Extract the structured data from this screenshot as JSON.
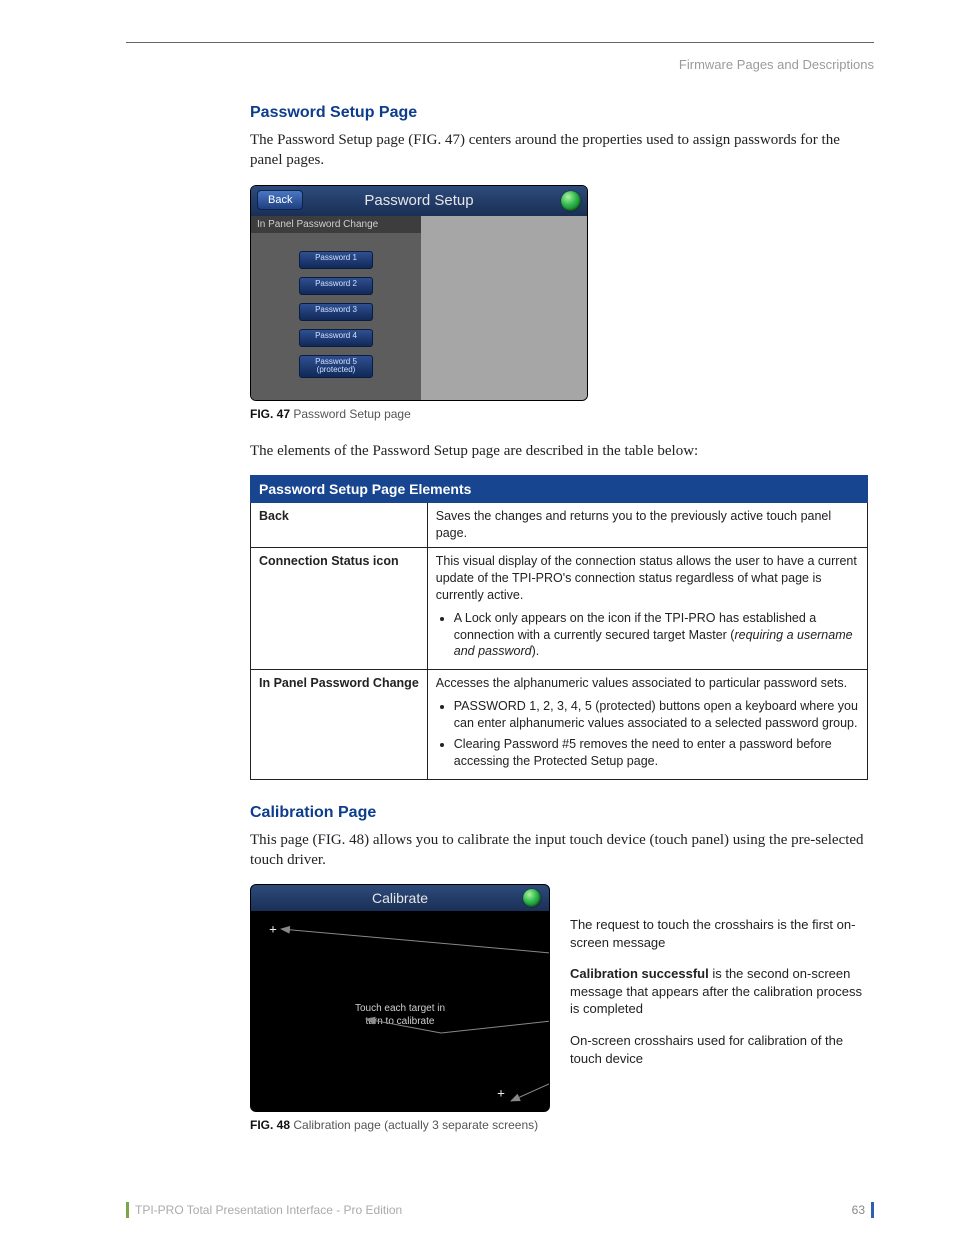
{
  "header": {
    "breadcrumb": "Firmware Pages and Descriptions"
  },
  "section1": {
    "title": "Password Setup Page",
    "intro": "The Password Setup page (FIG. 47) centers around the properties used to assign passwords for the panel pages."
  },
  "fig47": {
    "back_label": "Back",
    "panel_title": "Password Setup",
    "left_header": "In Panel Password Change",
    "buttons": [
      "Password 1",
      "Password 2",
      "Password 3",
      "Password 4",
      "Password 5\n(protected)"
    ],
    "caption_bold": "FIG. 47",
    "caption_rest": "  Password Setup page"
  },
  "table_intro": "The elements of the Password Setup page are described in the table below:",
  "table": {
    "header": "Password Setup Page Elements",
    "rows": [
      {
        "key": "Back",
        "desc": "Saves the changes and returns you to the previously active touch panel page."
      },
      {
        "key": "Connection Status icon",
        "desc": "This visual display of the connection status allows the user to have a current update of the TPI-PRO's connection status regardless of what page is currently active.",
        "bullets": [
          {
            "pre": "A Lock only appears on the icon if the TPI-PRO has established a connection with a currently secured target Master (",
            "ital": "requiring a username and password",
            "post": ")."
          }
        ]
      },
      {
        "key": "In Panel Password Change",
        "desc": "Accesses the alphanumeric values associated to particular password sets.",
        "bullets": [
          {
            "pre": "PASSWORD 1, 2, 3, 4, 5 (protected) buttons open a keyboard where you can enter alphanumeric values associated to a selected password group."
          },
          {
            "pre": "Clearing Password #5 removes the need to enter a password before accessing the Protected Setup page."
          }
        ]
      }
    ]
  },
  "section2": {
    "title": "Calibration Page",
    "intro": "This page (FIG. 48) allows you to calibrate the input touch device (touch panel) using the pre-selected touch driver."
  },
  "fig48": {
    "panel_title": "Calibrate",
    "message": "Touch each target in\nturn to calibrate",
    "callout1": "The request to touch the crosshairs is the first on-screen message",
    "callout2_bold": "Calibration successful",
    "callout2_rest": " is the second on-screen message that appears after the calibration process is completed",
    "callout3": "On-screen crosshairs used for calibration of the touch device",
    "caption_bold": "FIG. 48",
    "caption_rest": "  Calibration page (actually 3 separate screens)"
  },
  "footer": {
    "left": "TPI-PRO Total Presentation Interface - Pro Edition",
    "page": "63"
  }
}
